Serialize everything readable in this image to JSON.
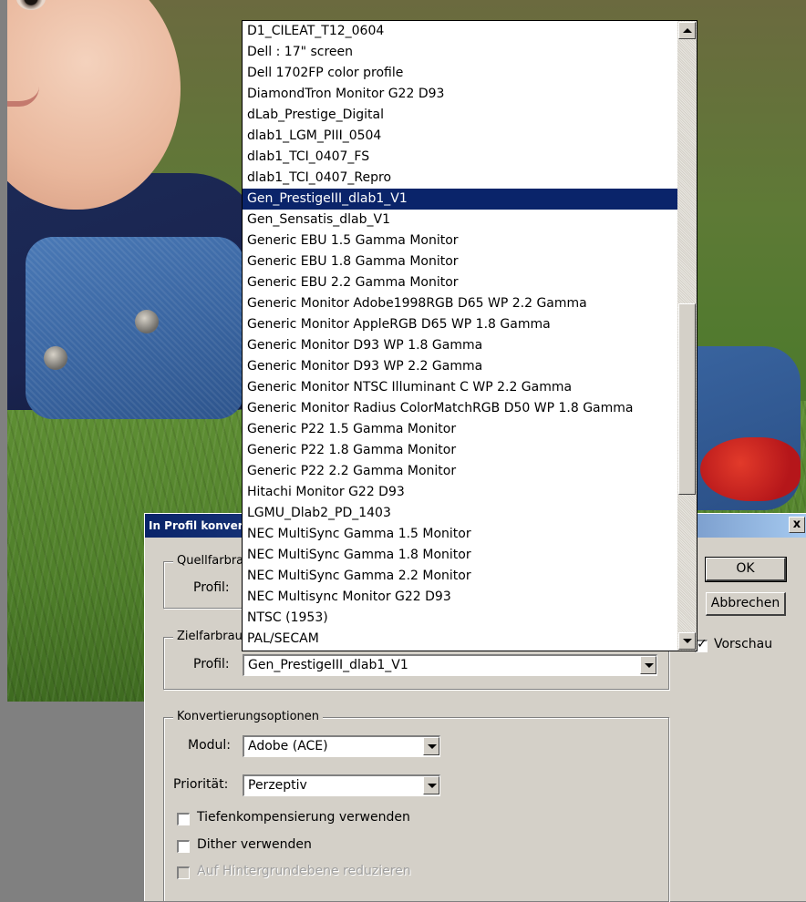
{
  "dialog": {
    "title": "In Profil konvertieren",
    "close_label": "x",
    "source_group": {
      "legend": "Quellfarbraum",
      "profile_label": "Profil:"
    },
    "target_group": {
      "legend": "Zielfarbraum",
      "profile_label": "Profil:",
      "profile_value": "Gen_PrestigeIII_dlab1_V1"
    },
    "conversion_group": {
      "legend": "Konvertierungsoptionen",
      "module_label": "Modul:",
      "module_value": "Adobe (ACE)",
      "priority_label": "Priorität:",
      "priority_value": "Perzeptiv",
      "blackpoint_label": "Tiefenkompensierung verwenden",
      "dither_label": "Dither verwenden",
      "flatten_label": "Auf Hintergrundebene reduzieren"
    },
    "ok_label": "OK",
    "cancel_label": "Abbrechen",
    "preview_label": "Vorschau"
  },
  "dropdown": {
    "items": [
      "D1_CILEAT_T12_0604",
      "Dell : 17\" screen",
      "Dell 1702FP color profile",
      "DiamondTron Monitor G22 D93",
      "dLab_Prestige_Digital",
      "dlab1_LGM_PIII_0504",
      "dlab1_TCI_0407_FS",
      "dlab1_TCI_0407_Repro",
      "Gen_PrestigeIII_dlab1_V1",
      "Gen_Sensatis_dlab_V1",
      "Generic EBU 1.5 Gamma Monitor",
      "Generic EBU 1.8 Gamma Monitor",
      "Generic EBU 2.2 Gamma Monitor",
      "Generic Monitor Adobe1998RGB D65 WP 2.2 Gamma",
      "Generic Monitor AppleRGB D65 WP 1.8 Gamma",
      "Generic Monitor D93 WP 1.8 Gamma",
      "Generic Monitor D93 WP 2.2 Gamma",
      "Generic Monitor NTSC Illuminant C WP 2.2 Gamma",
      "Generic Monitor Radius ColorMatchRGB D50 WP 1.8 Gamma",
      "Generic P22 1.5 Gamma Monitor",
      "Generic P22 1.8 Gamma Monitor",
      "Generic P22 2.2 Gamma Monitor",
      "Hitachi Monitor G22 D93",
      "LGMU_Dlab2_PD_1403",
      "NEC MultiSync Gamma 1.5 Monitor",
      "NEC MultiSync Gamma 1.8 Monitor",
      "NEC MultiSync Gamma 2.2 Monitor",
      "NEC Multisync Monitor G22 D93",
      "NTSC (1953)",
      "PAL/SECAM"
    ],
    "selected_index": 8
  }
}
